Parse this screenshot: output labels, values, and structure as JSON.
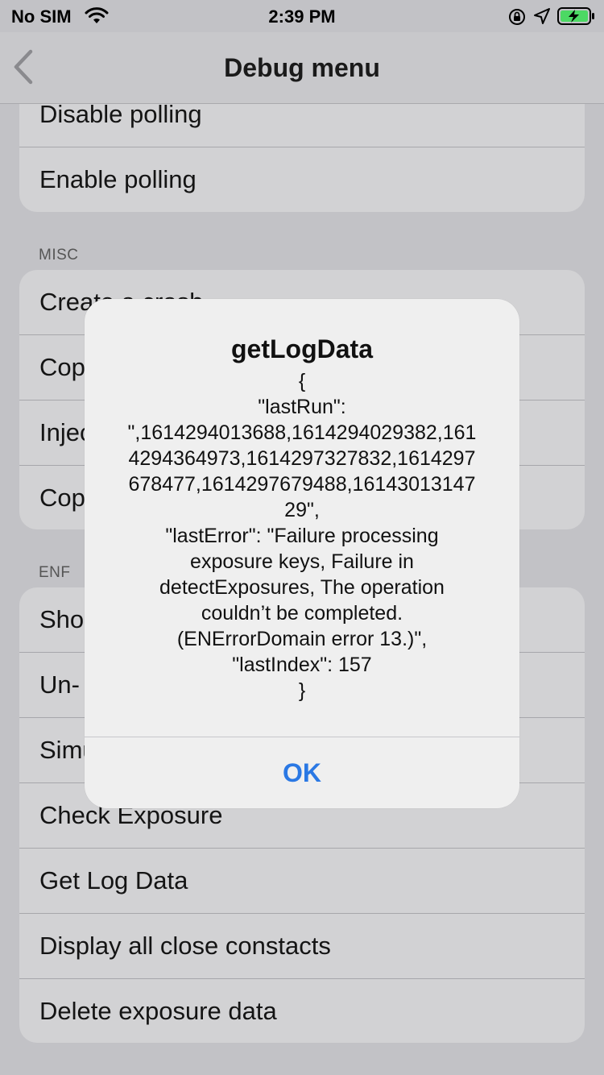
{
  "status_bar": {
    "carrier": "No SIM",
    "time": "2:39 PM",
    "icons": [
      "wifi-icon",
      "orientation-lock-icon",
      "location-icon",
      "battery-charging-icon"
    ],
    "battery_color": "#4cd964"
  },
  "nav": {
    "title": "Debug menu",
    "back_icon": "chevron-left-icon"
  },
  "groups": {
    "polling": {
      "rows": [
        "Disable polling",
        "Enable polling"
      ]
    },
    "misc": {
      "header": "MISC",
      "rows": [
        "Create a crash",
        "Cop",
        "Injec",
        "Cop"
      ]
    },
    "enf": {
      "header": "ENF",
      "rows": [
        "Sho",
        "Un-",
        "Simu",
        "Check Exposure",
        "Get Log Data",
        "Display all close constacts",
        "Delete exposure data"
      ]
    }
  },
  "alert": {
    "title": "getLogData",
    "message_lines": [
      "{",
      "\"lastRun\":",
      "\",1614294013688,1614294029382,161",
      "4294364973,1614297327832,1614297",
      "678477,1614297679488,16143013147",
      "29\",",
      "\"lastError\": \"Failure processing",
      "exposure keys, Failure in",
      "detectExposures, The operation",
      "couldn’t be completed.",
      "(ENErrorDomain error 13.)\",",
      "\"lastIndex\": 157",
      "}"
    ],
    "ok_label": "OK"
  },
  "colors": {
    "accent": "#2a78e4",
    "dim_background": "#c2c2c6"
  }
}
